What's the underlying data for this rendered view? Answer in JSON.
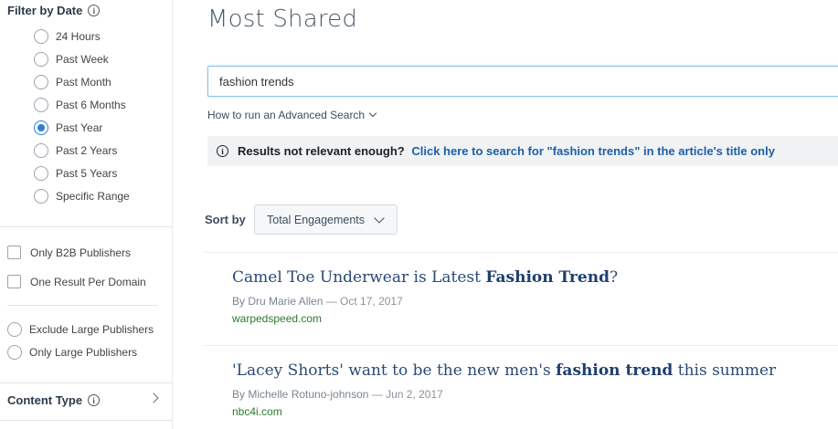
{
  "sidebar": {
    "date_filter": {
      "heading": "Filter by Date",
      "options": [
        "24 Hours",
        "Past Week",
        "Past Month",
        "Past 6 Months",
        "Past Year",
        "Past 2 Years",
        "Past 5 Years",
        "Specific Range"
      ],
      "selected": "Past Year"
    },
    "checkboxes": [
      "Only B2B Publishers",
      "One Result Per Domain"
    ],
    "publisher_size": [
      "Exclude Large Publishers",
      "Only Large Publishers"
    ],
    "content_type": {
      "heading": "Content Type"
    }
  },
  "main": {
    "title": "Most Shared",
    "search": {
      "value": "fashion trends"
    },
    "advanced_search_label": "How to run an Advanced Search",
    "notice": {
      "question": "Results not relevant enough?",
      "link": "Click here to search for \"fashion trends\" in the article's title only"
    },
    "sort": {
      "label": "Sort by",
      "value": "Total Engagements"
    },
    "results": [
      {
        "title_before": "Camel Toe Underwear is Latest ",
        "title_highlight": "Fashion Trend",
        "title_after": "?",
        "author": "By Dru Marie Allen",
        "separator": " — ",
        "date": "Oct 17, 2017",
        "domain": "warpedspeed.com"
      },
      {
        "title_before": "'Lacey Shorts' want to be the new men's ",
        "title_highlight": "fashion trend",
        "title_after": " this summer",
        "author": "By Michelle Rotuno-johnson",
        "separator": " — ",
        "date": "Jun 2, 2017",
        "domain": "nbc4i.com"
      }
    ]
  },
  "colors": {
    "accent": "#2d7fd8",
    "link": "#1f5fa6",
    "title": "#2a4a78",
    "domain": "#2c7a2c"
  }
}
